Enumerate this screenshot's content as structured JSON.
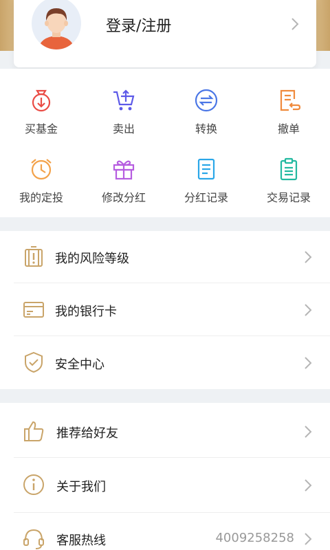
{
  "colors": {
    "accent_gold": "#c9a469",
    "chevron": "#b5b5b5"
  },
  "profile": {
    "login_label": "登录/注册",
    "avatar_icon": "user-avatar-icon",
    "chevron_icon": "chevron-right-icon"
  },
  "quick_actions": [
    {
      "label": "买基金",
      "icon": "buy-fund-icon",
      "color": "#ea4b44"
    },
    {
      "label": "卖出",
      "icon": "sell-cart-icon",
      "color": "#5c59e8"
    },
    {
      "label": "转换",
      "icon": "convert-icon",
      "color": "#4a76e6"
    },
    {
      "label": "撤单",
      "icon": "cancel-order-icon",
      "color": "#f08a3c"
    },
    {
      "label": "我的定投",
      "icon": "alarm-clock-icon",
      "color": "#f3a24a"
    },
    {
      "label": "修改分红",
      "icon": "gift-icon",
      "color": "#b65de0"
    },
    {
      "label": "分红记录",
      "icon": "dividend-record-icon",
      "color": "#2aa7e8"
    },
    {
      "label": "交易记录",
      "icon": "clipboard-icon",
      "color": "#22b9a0"
    }
  ],
  "menu_group1": [
    {
      "label": "我的风险等级",
      "icon": "risk-warning-icon"
    },
    {
      "label": "我的银行卡",
      "icon": "bank-card-icon"
    },
    {
      "label": "安全中心",
      "icon": "shield-check-icon"
    }
  ],
  "menu_group2": [
    {
      "label": "推荐给好友",
      "icon": "thumbs-up-icon"
    },
    {
      "label": "关于我们",
      "icon": "info-icon"
    },
    {
      "label": "客服热线",
      "icon": "headset-icon",
      "value": "4009258258"
    }
  ]
}
